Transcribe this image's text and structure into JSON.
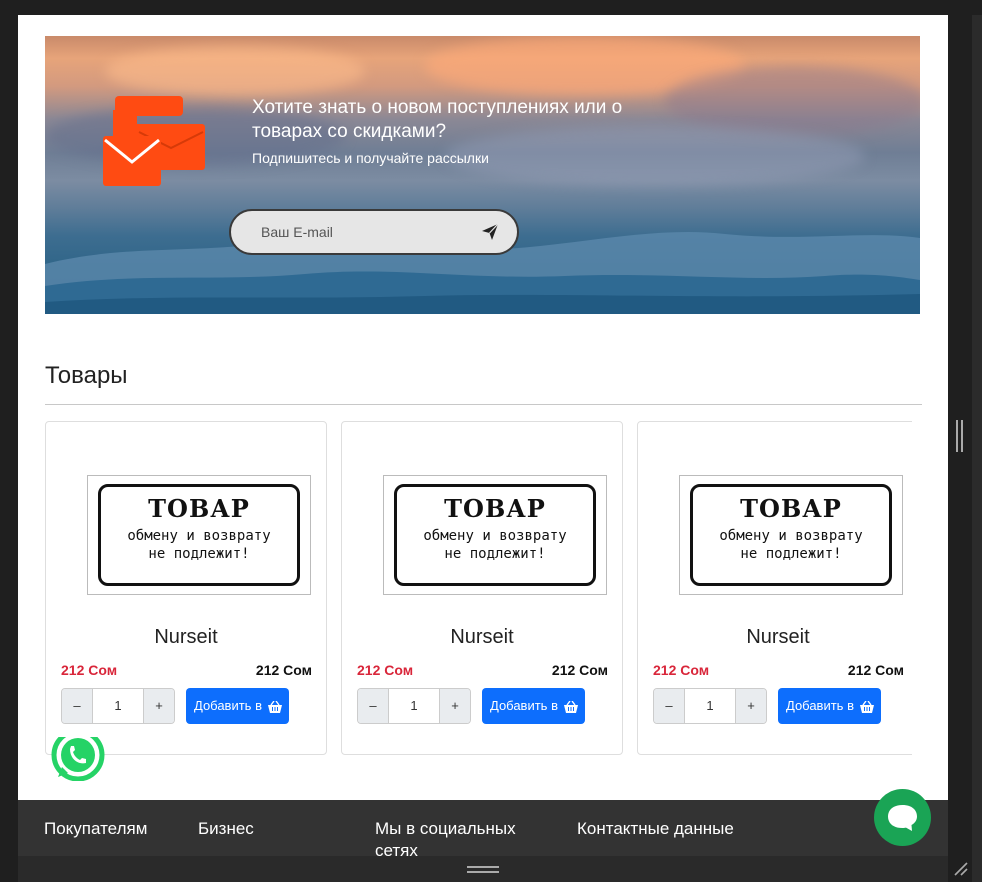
{
  "subscribe": {
    "title": "Хотите знать о новом поступлениях или о товарах со скидками?",
    "subtitle": "Подпишитесь и получайте рассылки",
    "email_placeholder": "Ваш E-mail"
  },
  "products_section": {
    "title": "Товары",
    "items": [
      {
        "image_title": "ТОВАР",
        "image_line1": "обмену и возврату",
        "image_line2": "не подлежит!",
        "name": "Nurseit",
        "old_price": "212 Сом",
        "price": "212 Сом",
        "qty": "1",
        "minus": "–",
        "plus": "+",
        "add_label": "Добавить в"
      },
      {
        "image_title": "ТОВАР",
        "image_line1": "обмену и возврату",
        "image_line2": "не подлежит!",
        "name": "Nurseit",
        "old_price": "212 Сом",
        "price": "212 Сом",
        "qty": "1",
        "minus": "–",
        "plus": "+",
        "add_label": "Добавить в"
      },
      {
        "image_title": "ТОВАР",
        "image_line1": "обмену и возврату",
        "image_line2": "не подлежит!",
        "name": "Nurseit",
        "old_price": "212 Сом",
        "price": "212 Сом",
        "qty": "1",
        "minus": "–",
        "plus": "+",
        "add_label": "Добавить в"
      }
    ]
  },
  "footer": {
    "buyers": "Покупателям",
    "business": "Бизнес",
    "social": "Мы в социальных сетях",
    "contacts": "Контактные данные"
  },
  "icons": {
    "mail_logo": "mail-envelopes-icon",
    "send": "paper-plane-icon",
    "cart": "basket-icon",
    "whatsapp": "whatsapp-icon",
    "chat": "chat-bubble-icon"
  },
  "colors": {
    "accent_orange": "#ff4b12",
    "button_blue": "#0d6efd",
    "old_price_red": "#d9263a",
    "footer_bg": "#333333",
    "chat_green": "#1aa455"
  }
}
